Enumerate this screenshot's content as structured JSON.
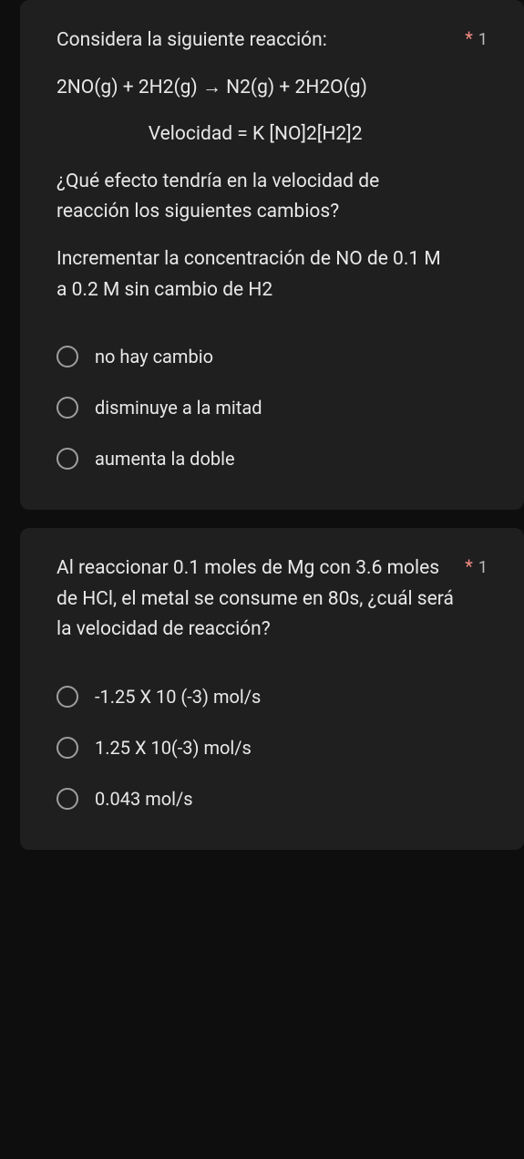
{
  "questions": [
    {
      "required_mark": "*",
      "points": "1",
      "blocks": [
        {
          "text": "Considera la siguiente reacción:",
          "centered": false
        },
        {
          "text": "2NO(g) + 2H2(g)  →  N2(g) + 2H2O(g)",
          "centered": false
        },
        {
          "text": "Velocidad = K [NO]2[H2]2",
          "centered": true
        },
        {
          "text": "¿Qué efecto tendría en la velocidad de reacción los siguientes cambios?",
          "centered": false
        },
        {
          "text": " Incrementar la concentración de NO de 0.1 M a 0.2 M sin cambio de H2",
          "centered": false
        }
      ],
      "options": [
        {
          "label": "no hay cambio"
        },
        {
          "label": "disminuye a la mitad"
        },
        {
          "label": "aumenta la doble"
        }
      ]
    },
    {
      "required_mark": "*",
      "points": "1",
      "blocks": [
        {
          "text": "Al reaccionar 0.1 moles de Mg con 3.6 moles de HCl, el metal se consume en 80s, ¿cuál será la velocidad de reacción?",
          "centered": false
        }
      ],
      "options": [
        {
          "label": "-1.25 X 10 (-3) mol/s"
        },
        {
          "label": "1.25 X 10(-3) mol/s"
        },
        {
          "label": "0.043 mol/s"
        }
      ]
    }
  ]
}
